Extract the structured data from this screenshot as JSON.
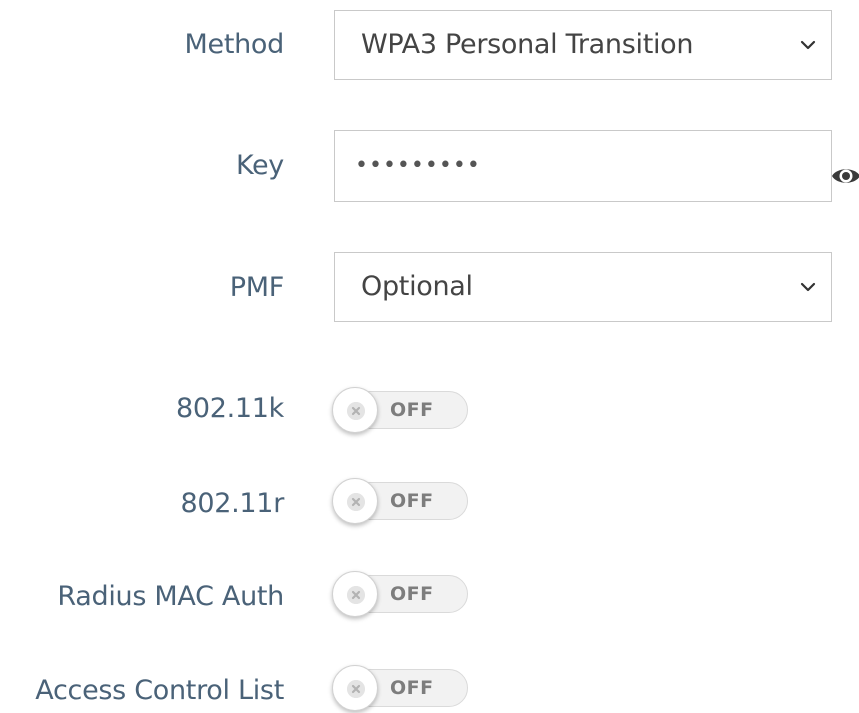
{
  "form": {
    "method": {
      "label": "Method",
      "selected": "WPA3 Personal Transition",
      "icon": "chevron-down-icon"
    },
    "key": {
      "label": "Key",
      "value_masked": "•••••••••",
      "icon": "eye-icon"
    },
    "pmf": {
      "label": "PMF",
      "selected": "Optional",
      "icon": "chevron-down-icon"
    },
    "toggles": [
      {
        "label": "802.11k",
        "state": "OFF"
      },
      {
        "label": "802.11r",
        "state": "OFF"
      },
      {
        "label": "Radius MAC Auth",
        "state": "OFF"
      },
      {
        "label": "Access Control List",
        "state": "OFF"
      }
    ]
  },
  "colors": {
    "label": "#4a6278",
    "border": "#c9c9c9",
    "value": "#444444",
    "toggle_text": "#7d7d7d"
  }
}
